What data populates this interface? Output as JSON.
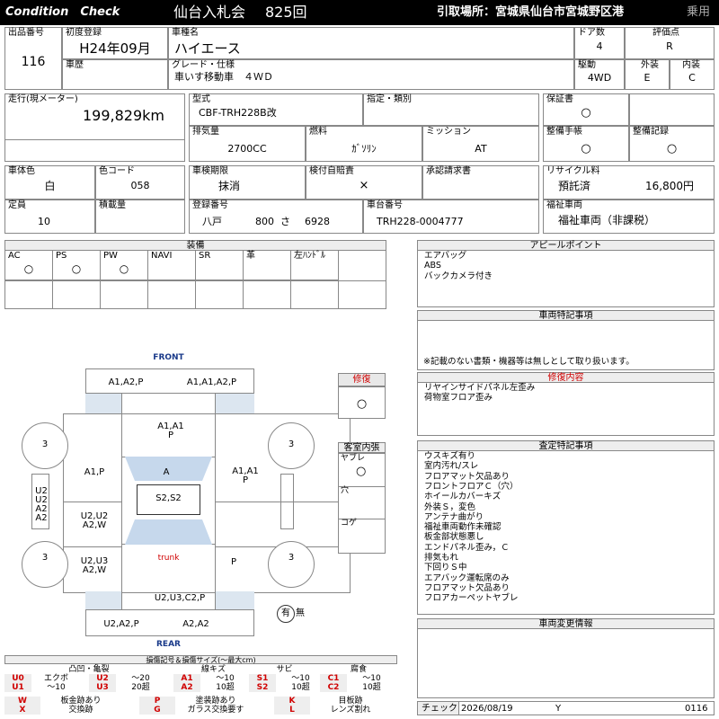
{
  "header": {
    "brand": "Condition　Check",
    "auction": "仙台入札会",
    "lot": "825回",
    "pickup": "引取場所：宮城県仙台市宮城野区港",
    "category": "乗用"
  },
  "vehicle": {
    "lot_no_label": "出品番号",
    "lot_no": "116",
    "first_reg_label": "初度登録",
    "first_reg": "H24年09月",
    "history_label": "車歴",
    "name_label": "車種名",
    "name": "ハイエース",
    "grade_label": "グレード・仕様",
    "grade": "車いす移動車　４ＷＤ",
    "doors_label": "ドア数",
    "doors": "4",
    "score_label": "評価点",
    "score": "R",
    "drive_label": "駆動",
    "drive": "4WD",
    "ext_label": "外装",
    "ext": "E",
    "int_label": "内装",
    "int": "C",
    "mileage_label": "走行(現メーター)",
    "mileage": "199,829km",
    "model_label": "型式",
    "model": "CBF-TRH228B改",
    "designation_label": "指定・類別",
    "warranty_label": "保証書",
    "warranty": "○",
    "disp_label": "排気量",
    "disp": "2700CC",
    "fuel_label": "燃料",
    "fuel": "ｶﾞｿﾘﾝ",
    "mission_label": "ミッション",
    "mission": "AT",
    "manual_label": "整備手帳",
    "manual": "○",
    "record_label": "整備記録",
    "record": "○",
    "color_label": "車体色",
    "color": "白",
    "color_code_label": "色コード",
    "color_code": "058",
    "inspection_label": "車検期限",
    "inspection": "抹消",
    "kenshi_label": "検付自賠責",
    "kenshi": "×",
    "approval_label": "承認請求書",
    "recycle_label": "リサイクル料",
    "recycle_status": "預託済",
    "recycle_amount": "16,800円",
    "capacity_label": "定員",
    "capacity": "10",
    "load_label": "積載量",
    "plate_label": "登録番号",
    "plate_area": "八戸",
    "plate_class": "800",
    "plate_kana": "さ",
    "plate_no": "6928",
    "chassis_label": "車台番号",
    "chassis": "TRH228-0004777",
    "welfare_label": "福祉車両",
    "welfare": "福祉車両（非課税）"
  },
  "equipment": {
    "title": "装備",
    "items": [
      {
        "label": "AC",
        "mark": "○"
      },
      {
        "label": "PS",
        "mark": "○"
      },
      {
        "label": "PW",
        "mark": "○"
      },
      {
        "label": "NAVI",
        "mark": ""
      },
      {
        "label": "SR",
        "mark": ""
      },
      {
        "label": "革",
        "mark": ""
      },
      {
        "label": "左ﾊﾝﾄﾞﾙ",
        "mark": ""
      }
    ]
  },
  "diagram": {
    "front": "FRONT",
    "rear": "REAR",
    "trunk": "trunk",
    "front_left": "A1,A2,P",
    "front_right": "A1,A1,A2,P",
    "hood": "A1,A1\nP",
    "roof": "A",
    "roof_inner": "S2,S2",
    "left_front_door": "A1,P",
    "right_front_door": "A1,A1\nP",
    "left_rear_door": "U2,U2\nA2,W",
    "right_rear_door": "",
    "left_quarter": "U2,U3\nA2,W",
    "right_quarter": "P",
    "rear_panel": "U2,U3,C2,P",
    "rear_left": "U2,A2,P",
    "rear_right": "A2,A2",
    "wheel": "3",
    "left_side": "U2\nU2\nA2\nA2",
    "spare": "有",
    "spare_none": "無"
  },
  "repair": {
    "title": "修復",
    "mark": "○"
  },
  "cabin": {
    "title": "客室内張",
    "rows": [
      {
        "label": "ヤブレ",
        "mark": "○"
      },
      {
        "label": "穴",
        "mark": ""
      },
      {
        "label": "コゲ",
        "mark": ""
      }
    ]
  },
  "appeal": {
    "title": "アピールポイント",
    "lines": [
      "エアバッグ",
      "ABS",
      "バックカメラ付き"
    ]
  },
  "special": {
    "title": "車両特記事項",
    "note": "※記載のない書類・機器等は無しとして取り扱います。"
  },
  "repair_detail": {
    "title": "修復内容",
    "lines": [
      "リヤインサイドパネル左歪み",
      "荷物室フロア歪み"
    ]
  },
  "assess": {
    "title": "査定特記事項",
    "lines": [
      "ウスキズ有り",
      "室内汚れ/スレ",
      "フロアマット欠品あり",
      "フロントフロアＣ（穴）",
      "ホイールカバーキズ",
      "外装Ｓ，変色",
      "アンテナ曲がり",
      "福祉車両動作未確認",
      "板金部状態悪し",
      "エンドパネル歪み，Ｃ",
      "排気もれ",
      "下回りＳ中",
      "エアバック運転席のみ",
      "フロアマット欠品あり",
      "フロアカーペットヤブレ"
    ]
  },
  "change": {
    "title": "車両変更情報"
  },
  "check": {
    "label": "チェック",
    "date": "2026/08/19",
    "mark": "Y",
    "code": "0116"
  },
  "legend": {
    "title": "損傷記号＆損傷サイズ(～最大cm)",
    "groups": [
      "凸凹・亀裂",
      "線キズ",
      "サビ",
      "腐食"
    ],
    "rows": [
      [
        {
          "c": "U0",
          "t": "エクボ"
        },
        {
          "c": "U2",
          "t": "～20"
        },
        {
          "c": "A1",
          "t": "～10"
        },
        {
          "c": "S1",
          "t": "～10"
        },
        {
          "c": "C1",
          "t": "～10"
        }
      ],
      [
        {
          "c": "U1",
          "t": "～10"
        },
        {
          "c": "U3",
          "t": "20超"
        },
        {
          "c": "A2",
          "t": "10超"
        },
        {
          "c": "S2",
          "t": "10超"
        },
        {
          "c": "C2",
          "t": "10超"
        }
      ]
    ],
    "bottom": [
      [
        {
          "c": "W",
          "t": "板金跡あり"
        },
        {
          "c": "P",
          "t": "塗装跡あり"
        },
        {
          "c": "K",
          "t": "目板跡"
        }
      ],
      [
        {
          "c": "X",
          "t": "交換跡"
        },
        {
          "c": "G",
          "t": "ガラス交換要す"
        },
        {
          "c": "L",
          "t": "レンズ割れ"
        }
      ]
    ]
  },
  "colors": {
    "header_bg": "#000000",
    "panel_blue": "#dce6f0",
    "mark_red": "#d00000",
    "repair_red": "#d00000"
  }
}
